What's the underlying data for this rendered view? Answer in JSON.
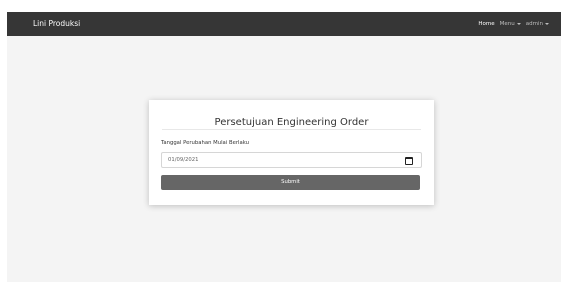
{
  "navbar": {
    "brand": "Lini Produksi",
    "home": "Home",
    "menu": "Menu",
    "user": "admin"
  },
  "form": {
    "title": "Persetujuan Engineering Order",
    "date_label": "Tanggal Perubahan Mulai Berlaku",
    "date_value": "01/09/2021",
    "submit_label": "Submit"
  },
  "icons": [
    "calendar-icon",
    "caret-down-icon"
  ],
  "colors": {
    "navbar": "#363636",
    "background": "#f4f4f4",
    "button": "#666666"
  }
}
